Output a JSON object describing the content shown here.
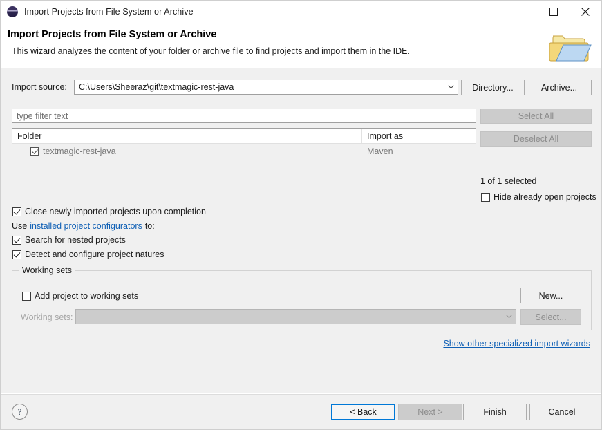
{
  "window": {
    "title": "Import Projects from File System or Archive",
    "icon": "eclipse-icon",
    "minimize": "minimize-icon",
    "maximize": "maximize-icon",
    "close": "close-icon"
  },
  "banner": {
    "title": "Import Projects from File System or Archive",
    "description": "This wizard analyzes the content of your folder or archive file to find projects and import them in the IDE.",
    "icon": "import-folder-icon"
  },
  "import_source": {
    "label": "Import source:",
    "value": "C:\\Users\\Sheeraz\\git\\textmagic-rest-java",
    "directory_button": "Directory...",
    "archive_button": "Archive..."
  },
  "filter": {
    "placeholder": "type filter text",
    "value": ""
  },
  "table": {
    "columns": [
      "Folder",
      "Import as"
    ],
    "rows": [
      {
        "folder": "textmagic-rest-java",
        "import_as": "Maven",
        "checked": true
      }
    ]
  },
  "selection_panel": {
    "select_all": "Select All",
    "deselect_all": "Deselect All",
    "status": "1 of 1 selected",
    "hide_open_projects": "Hide already open projects"
  },
  "options": {
    "close_newly_imported": "Close newly imported projects upon completion",
    "use_prefix": "Use",
    "configurators_link": "installed project configurators",
    "use_suffix": "to:",
    "search_nested": "Search for nested projects",
    "detect_natures": "Detect and configure project natures"
  },
  "working_sets": {
    "group_title": "Working sets",
    "add_project": "Add project to working sets",
    "sets_label": "Working sets:",
    "sets_value": "",
    "new_button": "New...",
    "select_button": "Select..."
  },
  "other_wizards_link": "Show other specialized import wizards",
  "footer": {
    "help": "?",
    "back": "< Back",
    "next": "Next >",
    "finish": "Finish",
    "cancel": "Cancel"
  },
  "colors": {
    "accent": "#0078d7",
    "link": "#0e5fb5",
    "dialog_bg": "#f0f0f0"
  }
}
